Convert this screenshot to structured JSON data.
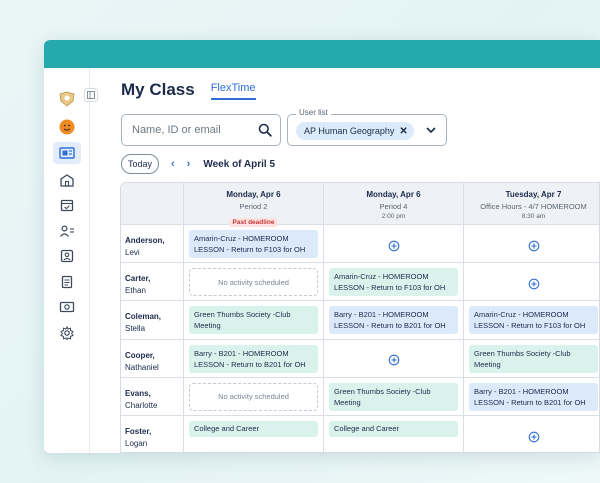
{
  "header": {
    "title": "My Class",
    "tab": "FlexTime"
  },
  "search": {
    "placeholder": "Name, ID or email"
  },
  "userlist": {
    "label": "User list",
    "chip": "AP Human Geography"
  },
  "nav": {
    "today": "Today",
    "prev": "‹",
    "next": "›",
    "week": "Week of April 5"
  },
  "sidebar": {
    "icons": [
      "logo-icon",
      "avatar-icon",
      "flextime-icon",
      "school-icon",
      "calendar-icon",
      "users-icon",
      "contact-card-icon",
      "document-icon",
      "id-card-icon",
      "settings-icon"
    ]
  },
  "columns": [
    {
      "day": "Monday, Apr 6",
      "sub": "Period 2",
      "badge": "Past deadline",
      "time": ""
    },
    {
      "day": "Monday, Apr 6",
      "sub": "Period 4",
      "badge": "",
      "time": "2:00 pm"
    },
    {
      "day": "Tuesday, Apr 7",
      "sub": "Office Hours - 4/7 HOMEROOM",
      "badge": "",
      "time": "8:30 am"
    }
  ],
  "rows": [
    {
      "last": "Anderson,",
      "first": "Levi",
      "cells": [
        {
          "type": "activity",
          "color": "blue",
          "text": "Amarin-Cruz - HOMEROOM LESSON - Return to F103 for OH"
        },
        {
          "type": "add"
        },
        {
          "type": "add"
        }
      ]
    },
    {
      "last": "Carter,",
      "first": "Ethan",
      "cells": [
        {
          "type": "empty",
          "text": "No activity scheduled"
        },
        {
          "type": "activity",
          "color": "green",
          "text": "Amarin-Cruz - HOMEROOM LESSON - Return to F103 for OH"
        },
        {
          "type": "add"
        }
      ]
    },
    {
      "last": "Coleman,",
      "first": "Stella",
      "cells": [
        {
          "type": "activity",
          "color": "green",
          "text": "Green Thumbs Society -Club Meeting"
        },
        {
          "type": "activity",
          "color": "blue",
          "text": "Barry - B201 - HOMEROOM LESSON - Return to B201 for OH"
        },
        {
          "type": "activity",
          "color": "blue",
          "text": "Amarin-Cruz - HOMEROOM LESSON - Return to F103 for OH"
        }
      ]
    },
    {
      "last": "Cooper,",
      "first": "Nathaniel",
      "cells": [
        {
          "type": "activity",
          "color": "green",
          "text": "Barry - B201 - HOMEROOM LESSON - Return to B201 for OH"
        },
        {
          "type": "add"
        },
        {
          "type": "activity",
          "color": "green",
          "text": "Green Thumbs Society -Club Meeting"
        }
      ]
    },
    {
      "last": "Evans,",
      "first": "Charlotte",
      "cells": [
        {
          "type": "empty",
          "text": "No activity scheduled"
        },
        {
          "type": "activity",
          "color": "green",
          "text": "Green Thumbs Society -Club Meeting"
        },
        {
          "type": "activity",
          "color": "blue",
          "text": "Barry - B201 - HOMEROOM LESSON - Return to B201 for OH"
        }
      ]
    },
    {
      "last": "Foster,",
      "first": "Logan",
      "cells": [
        {
          "type": "activity",
          "color": "green",
          "text": "College and Career"
        },
        {
          "type": "activity",
          "color": "green",
          "text": "College and Career"
        },
        {
          "type": "add"
        }
      ]
    }
  ],
  "colors": {
    "topbar": "#26a9ad",
    "accent": "#2f6fd6",
    "blue_card": "#dce9fb",
    "green_card": "#d9f3ec"
  }
}
